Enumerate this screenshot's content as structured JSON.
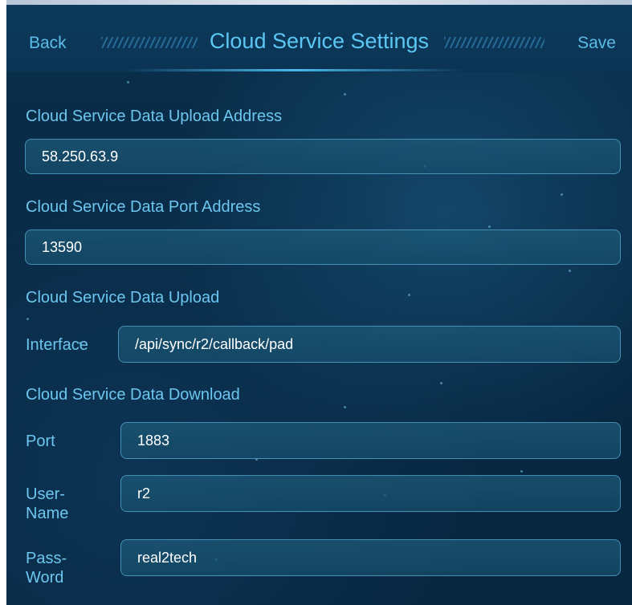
{
  "header": {
    "back_label": "Back",
    "title": "Cloud Service Settings",
    "save_label": "Save"
  },
  "upload_address": {
    "label": "Cloud Service Data Upload Address",
    "value": "58.250.63.9"
  },
  "port_address": {
    "label": "Cloud Service Data Port Address",
    "value": "13590"
  },
  "upload_interface": {
    "section_label": "Cloud Service Data Upload",
    "field_label": "Interface",
    "value": "/api/sync/r2/callback/pad"
  },
  "download": {
    "section_label": "Cloud Service Data Download",
    "port_label": "Port",
    "port_value": "1883",
    "username_label_line1": "User-",
    "username_label_line2": "Name",
    "username_value": "r2",
    "password_label_line1": "Pass-",
    "password_label_line2": "Word",
    "password_value": "real2tech"
  },
  "colors": {
    "accent": "#5cc7f2",
    "label": "#6cc6ee",
    "background": "#082a45",
    "field_border": "#6ec8f0"
  }
}
